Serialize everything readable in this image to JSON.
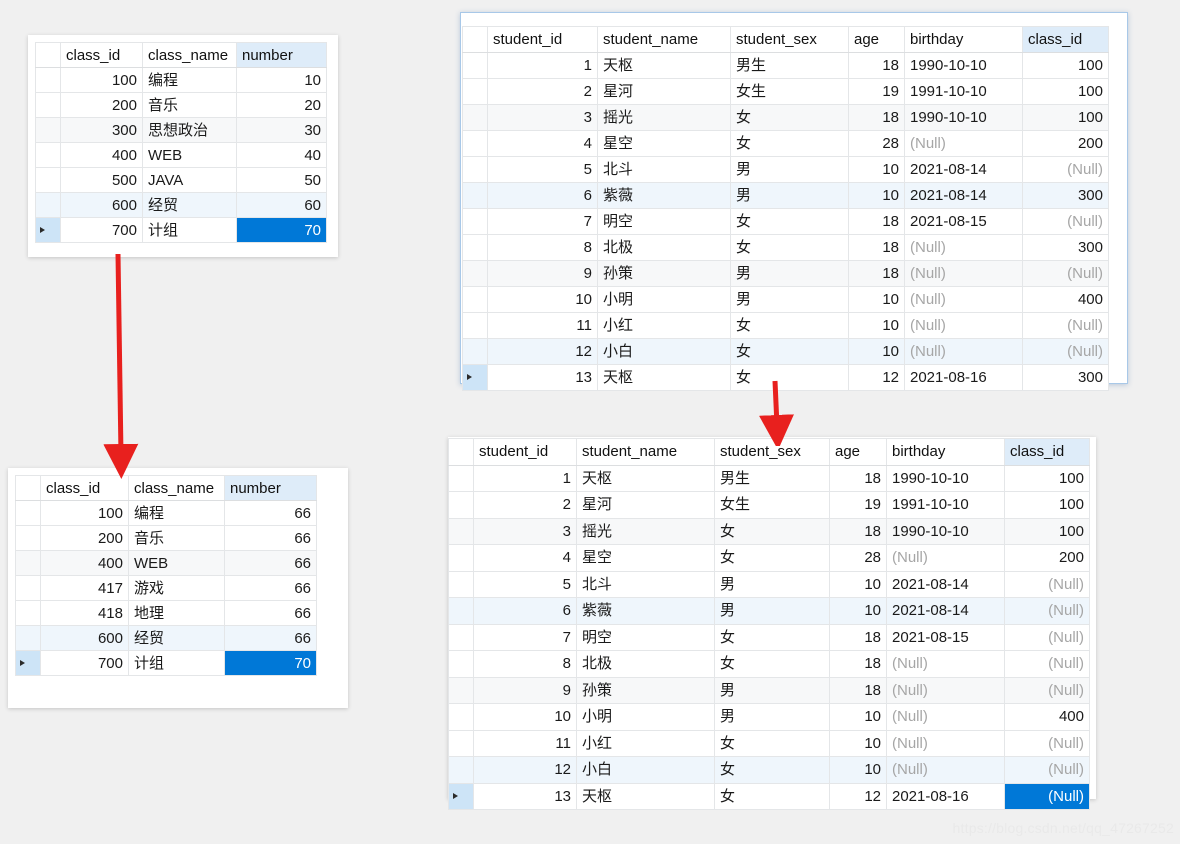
{
  "watermark": "https://blog.csdn.net/qq_47267252",
  "colors": {
    "selection": "#0078D7",
    "header_highlight": "#DEECF9",
    "alt_row_gray": "#F7F8F9",
    "alt_row_blue": "#EFF6FC",
    "null_text": "#A6A6A6",
    "arrow": "#E8201E",
    "panel_border_blue": "#A8C8E8"
  },
  "class_table_before": {
    "name": "class-result-before",
    "columns": [
      "class_id",
      "class_name",
      "number"
    ],
    "highlight_column": "number",
    "rows": [
      {
        "class_id": "100",
        "class_name": "编程",
        "number": "10"
      },
      {
        "class_id": "200",
        "class_name": "音乐",
        "number": "20"
      },
      {
        "class_id": "300",
        "class_name": "思想政治",
        "number": "30"
      },
      {
        "class_id": "400",
        "class_name": "WEB",
        "number": "40"
      },
      {
        "class_id": "500",
        "class_name": "JAVA",
        "number": "50"
      },
      {
        "class_id": "600",
        "class_name": "经贸",
        "number": "60"
      },
      {
        "class_id": "700",
        "class_name": "计组",
        "number": "70"
      }
    ],
    "selected_cell": {
      "row": 6,
      "column": "number",
      "value": "70"
    },
    "current_row": 6,
    "alt_rows": {
      "gray": [
        2
      ],
      "blue": [
        5
      ]
    }
  },
  "class_table_after": {
    "name": "class-result-after",
    "columns": [
      "class_id",
      "class_name",
      "number"
    ],
    "highlight_column": "number",
    "rows": [
      {
        "class_id": "100",
        "class_name": "编程",
        "number": "66"
      },
      {
        "class_id": "200",
        "class_name": "音乐",
        "number": "66"
      },
      {
        "class_id": "400",
        "class_name": "WEB",
        "number": "66"
      },
      {
        "class_id": "417",
        "class_name": "游戏",
        "number": "66"
      },
      {
        "class_id": "418",
        "class_name": "地理",
        "number": "66"
      },
      {
        "class_id": "600",
        "class_name": "经贸",
        "number": "66"
      },
      {
        "class_id": "700",
        "class_name": "计组",
        "number": "70"
      }
    ],
    "selected_cell": {
      "row": 6,
      "column": "number",
      "value": "70"
    },
    "current_row": 6,
    "alt_rows": {
      "gray": [
        2
      ],
      "blue": [
        5
      ]
    }
  },
  "student_table_before": {
    "name": "student-result-before",
    "columns": [
      "student_id",
      "student_name",
      "student_sex",
      "age",
      "birthday",
      "class_id"
    ],
    "highlight_column": "class_id",
    "null_label": "(Null)",
    "rows": [
      {
        "student_id": "1",
        "student_name": "天枢",
        "student_sex": "男生",
        "age": "18",
        "birthday": "1990-10-10",
        "class_id": "100"
      },
      {
        "student_id": "2",
        "student_name": "星河",
        "student_sex": "女生",
        "age": "19",
        "birthday": "1991-10-10",
        "class_id": "100"
      },
      {
        "student_id": "3",
        "student_name": "摇光",
        "student_sex": "女",
        "age": "18",
        "birthday": "1990-10-10",
        "class_id": "100"
      },
      {
        "student_id": "4",
        "student_name": "星空",
        "student_sex": "女",
        "age": "28",
        "birthday": "(Null)",
        "class_id": "200"
      },
      {
        "student_id": "5",
        "student_name": "北斗",
        "student_sex": "男",
        "age": "10",
        "birthday": "2021-08-14",
        "class_id": "(Null)"
      },
      {
        "student_id": "6",
        "student_name": "紫薇",
        "student_sex": "男",
        "age": "10",
        "birthday": "2021-08-14",
        "class_id": "300"
      },
      {
        "student_id": "7",
        "student_name": "明空",
        "student_sex": "女",
        "age": "18",
        "birthday": "2021-08-15",
        "class_id": "(Null)"
      },
      {
        "student_id": "8",
        "student_name": "北极",
        "student_sex": "女",
        "age": "18",
        "birthday": "(Null)",
        "class_id": "300"
      },
      {
        "student_id": "9",
        "student_name": "孙策",
        "student_sex": "男",
        "age": "18",
        "birthday": "(Null)",
        "class_id": "(Null)"
      },
      {
        "student_id": "10",
        "student_name": "小明",
        "student_sex": "男",
        "age": "10",
        "birthday": "(Null)",
        "class_id": "400"
      },
      {
        "student_id": "11",
        "student_name": "小红",
        "student_sex": "女",
        "age": "10",
        "birthday": "(Null)",
        "class_id": "(Null)"
      },
      {
        "student_id": "12",
        "student_name": "小白",
        "student_sex": "女",
        "age": "10",
        "birthday": "(Null)",
        "class_id": "(Null)"
      },
      {
        "student_id": "13",
        "student_name": "天枢",
        "student_sex": "女",
        "age": "12",
        "birthday": "2021-08-16",
        "class_id": "300"
      }
    ],
    "selected_cell": null,
    "current_row": 12,
    "alt_rows": {
      "gray": [
        2,
        8
      ],
      "blue": [
        5,
        11
      ]
    }
  },
  "student_table_after": {
    "name": "student-result-after",
    "columns": [
      "student_id",
      "student_name",
      "student_sex",
      "age",
      "birthday",
      "class_id"
    ],
    "highlight_column": "class_id",
    "null_label": "(Null)",
    "rows": [
      {
        "student_id": "1",
        "student_name": "天枢",
        "student_sex": "男生",
        "age": "18",
        "birthday": "1990-10-10",
        "class_id": "100"
      },
      {
        "student_id": "2",
        "student_name": "星河",
        "student_sex": "女生",
        "age": "19",
        "birthday": "1991-10-10",
        "class_id": "100"
      },
      {
        "student_id": "3",
        "student_name": "摇光",
        "student_sex": "女",
        "age": "18",
        "birthday": "1990-10-10",
        "class_id": "100"
      },
      {
        "student_id": "4",
        "student_name": "星空",
        "student_sex": "女",
        "age": "28",
        "birthday": "(Null)",
        "class_id": "200"
      },
      {
        "student_id": "5",
        "student_name": "北斗",
        "student_sex": "男",
        "age": "10",
        "birthday": "2021-08-14",
        "class_id": "(Null)"
      },
      {
        "student_id": "6",
        "student_name": "紫薇",
        "student_sex": "男",
        "age": "10",
        "birthday": "2021-08-14",
        "class_id": "(Null)"
      },
      {
        "student_id": "7",
        "student_name": "明空",
        "student_sex": "女",
        "age": "18",
        "birthday": "2021-08-15",
        "class_id": "(Null)"
      },
      {
        "student_id": "8",
        "student_name": "北极",
        "student_sex": "女",
        "age": "18",
        "birthday": "(Null)",
        "class_id": "(Null)"
      },
      {
        "student_id": "9",
        "student_name": "孙策",
        "student_sex": "男",
        "age": "18",
        "birthday": "(Null)",
        "class_id": "(Null)"
      },
      {
        "student_id": "10",
        "student_name": "小明",
        "student_sex": "男",
        "age": "10",
        "birthday": "(Null)",
        "class_id": "400"
      },
      {
        "student_id": "11",
        "student_name": "小红",
        "student_sex": "女",
        "age": "10",
        "birthday": "(Null)",
        "class_id": "(Null)"
      },
      {
        "student_id": "12",
        "student_name": "小白",
        "student_sex": "女",
        "age": "10",
        "birthday": "(Null)",
        "class_id": "(Null)"
      },
      {
        "student_id": "13",
        "student_name": "天枢",
        "student_sex": "女",
        "age": "12",
        "birthday": "2021-08-16",
        "class_id": "(Null)"
      }
    ],
    "selected_cell": {
      "row": 12,
      "column": "class_id",
      "value": "(Null)"
    },
    "current_row": 12,
    "alt_rows": {
      "gray": [
        2,
        8
      ],
      "blue": [
        5,
        11
      ]
    }
  },
  "arrows": [
    {
      "name": "arrow-class-transition",
      "direction": "down",
      "color": "#E8201E"
    },
    {
      "name": "arrow-student-transition",
      "direction": "down",
      "color": "#E8201E"
    }
  ]
}
